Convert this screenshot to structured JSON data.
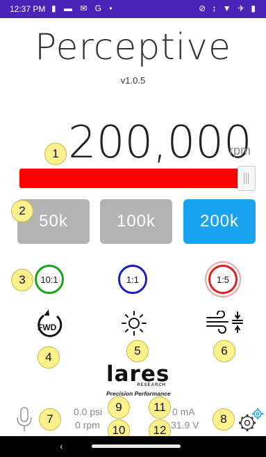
{
  "status_bar": {
    "time": "12:37 PM",
    "left_icons": "▮ ▬ ✉ G •",
    "right_icons": "⊘ ↕ ▼ ✈ ▮",
    "bg_color": "#4a23b8"
  },
  "app": {
    "title": "Perceptive",
    "version": "v1.0.5"
  },
  "speed": {
    "value": "200,000",
    "unit": "rpm",
    "slider_fraction": 1.0,
    "fill_color": "#ff0000"
  },
  "speed_buttons": [
    {
      "label": "50k",
      "active": false
    },
    {
      "label": "100k",
      "active": false
    },
    {
      "label": "200k",
      "active": true
    }
  ],
  "ratios": [
    {
      "label": "10:1",
      "color": "#17a317"
    },
    {
      "label": "1:1",
      "color": "#1c1cbf"
    },
    {
      "label": "1:5",
      "color": "#e02020"
    }
  ],
  "controls": {
    "direction_label": "FWD"
  },
  "logo": {
    "name": "lares",
    "subtitle": "RESEARCH",
    "tagline": "Precision Performance"
  },
  "readouts": {
    "pressure": "0.0 psi",
    "current": "0 mA",
    "speed": "0 rpm",
    "voltage": "31.9 V"
  },
  "badges": [
    "1",
    "2",
    "3",
    "4",
    "5",
    "6",
    "7",
    "8",
    "9",
    "10",
    "11",
    "12"
  ],
  "colors": {
    "badge_fill": "#fdf18e",
    "active_button": "#1aa3f0",
    "inactive_button": "#b3b3b3"
  },
  "icons": {
    "direction": "rotate-clockwise-icon",
    "light": "sun-icon",
    "air": "wind-compress-icon",
    "microphone": "microphone-icon",
    "settings": "gear-icon"
  }
}
